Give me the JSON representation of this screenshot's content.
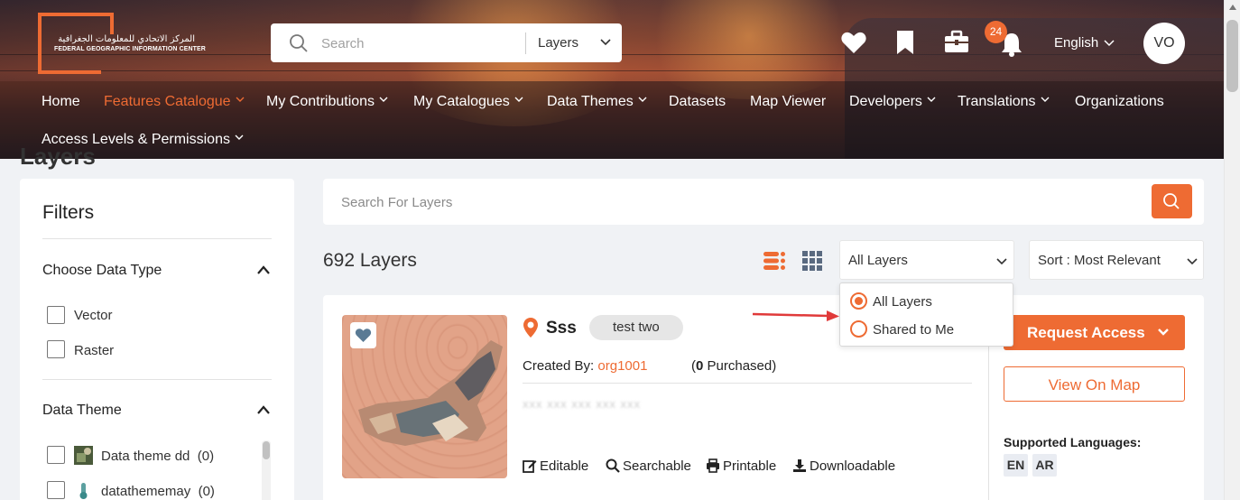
{
  "header": {
    "logo": {
      "arabic": "المركز الاتحادي للمعلومات الجغرافية",
      "english": "FEDERAL GEOGRAPHIC INFORMATION CENTER"
    },
    "search": {
      "placeholder": "Search",
      "scope": "Layers"
    },
    "notifications_count": "24",
    "language": "English",
    "user_initials": "VO"
  },
  "nav": {
    "items": [
      {
        "label": "Home"
      },
      {
        "label": "Features Catalogue"
      },
      {
        "label": "My Contributions"
      },
      {
        "label": "My Catalogues"
      },
      {
        "label": "Data Themes"
      },
      {
        "label": "Datasets"
      },
      {
        "label": "Map Viewer"
      },
      {
        "label": "Developers"
      },
      {
        "label": "Translations"
      },
      {
        "label": "Organizations"
      },
      {
        "label": "Access Levels & Permissions"
      }
    ]
  },
  "page": {
    "title": "Layers"
  },
  "filters": {
    "title": "Filters",
    "data_type": {
      "title": "Choose Data Type",
      "options": [
        "Vector",
        "Raster"
      ]
    },
    "data_theme": {
      "title": "Data Theme",
      "options": [
        {
          "label": "Data theme dd",
          "count": "(0)"
        },
        {
          "label": "datathememay",
          "count": "(0)"
        }
      ]
    }
  },
  "results": {
    "search_placeholder": "Search For Layers",
    "count_label": "692 Layers",
    "scope_select": "All Layers",
    "scope_options": [
      "All Layers",
      "Shared to Me"
    ],
    "sort_select": "Sort : Most Relevant"
  },
  "card": {
    "name": "Sss",
    "tag": "test two",
    "created_by_label": "Created By:",
    "created_by": "org1001",
    "purchased_open": "(",
    "purchased_count": "0",
    "purchased_label": " Purchased)",
    "description": "xxx xxx xxx xxx xxx",
    "features": [
      "Editable",
      "Searchable",
      "Printable",
      "Downloadable"
    ],
    "request_access": "Request Access",
    "view_on_map": "View On Map",
    "supported_languages_label": "Supported Languages:",
    "languages": [
      "EN",
      "AR"
    ]
  },
  "colors": {
    "accent": "#ee6b33"
  }
}
